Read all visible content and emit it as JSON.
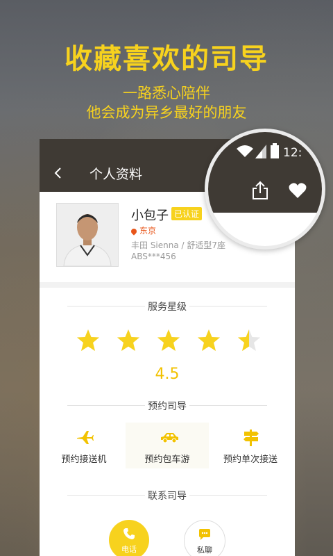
{
  "promo": {
    "headline": "收藏喜欢的司导",
    "sub1": "一路悉心陪伴",
    "sub2": "他会成为异乡最好的朋友"
  },
  "status": {
    "time": "12:"
  },
  "toolbar": {
    "title": "个人资料"
  },
  "profile": {
    "name": "小包子",
    "verified": "已认证",
    "location": "东京",
    "car": "丰田 Sienna",
    "car_separator": "/",
    "car_type": "舒适型7座",
    "plate": "ABS***456"
  },
  "service": {
    "title": "服务星级",
    "rating": "4.5",
    "stars_value": 4.5
  },
  "booking": {
    "title": "预约司导",
    "items": [
      {
        "label": "预约接送机",
        "icon": "plane-icon"
      },
      {
        "label": "预约包车游",
        "icon": "car-icon"
      },
      {
        "label": "预约单次接送",
        "icon": "signpost-icon"
      }
    ]
  },
  "contact": {
    "title": "联系司导",
    "phone": "电话",
    "chat": "私聊"
  },
  "colors": {
    "accent": "#f7d21e",
    "toolbar": "#3f3a34",
    "location": "#e8551a"
  }
}
